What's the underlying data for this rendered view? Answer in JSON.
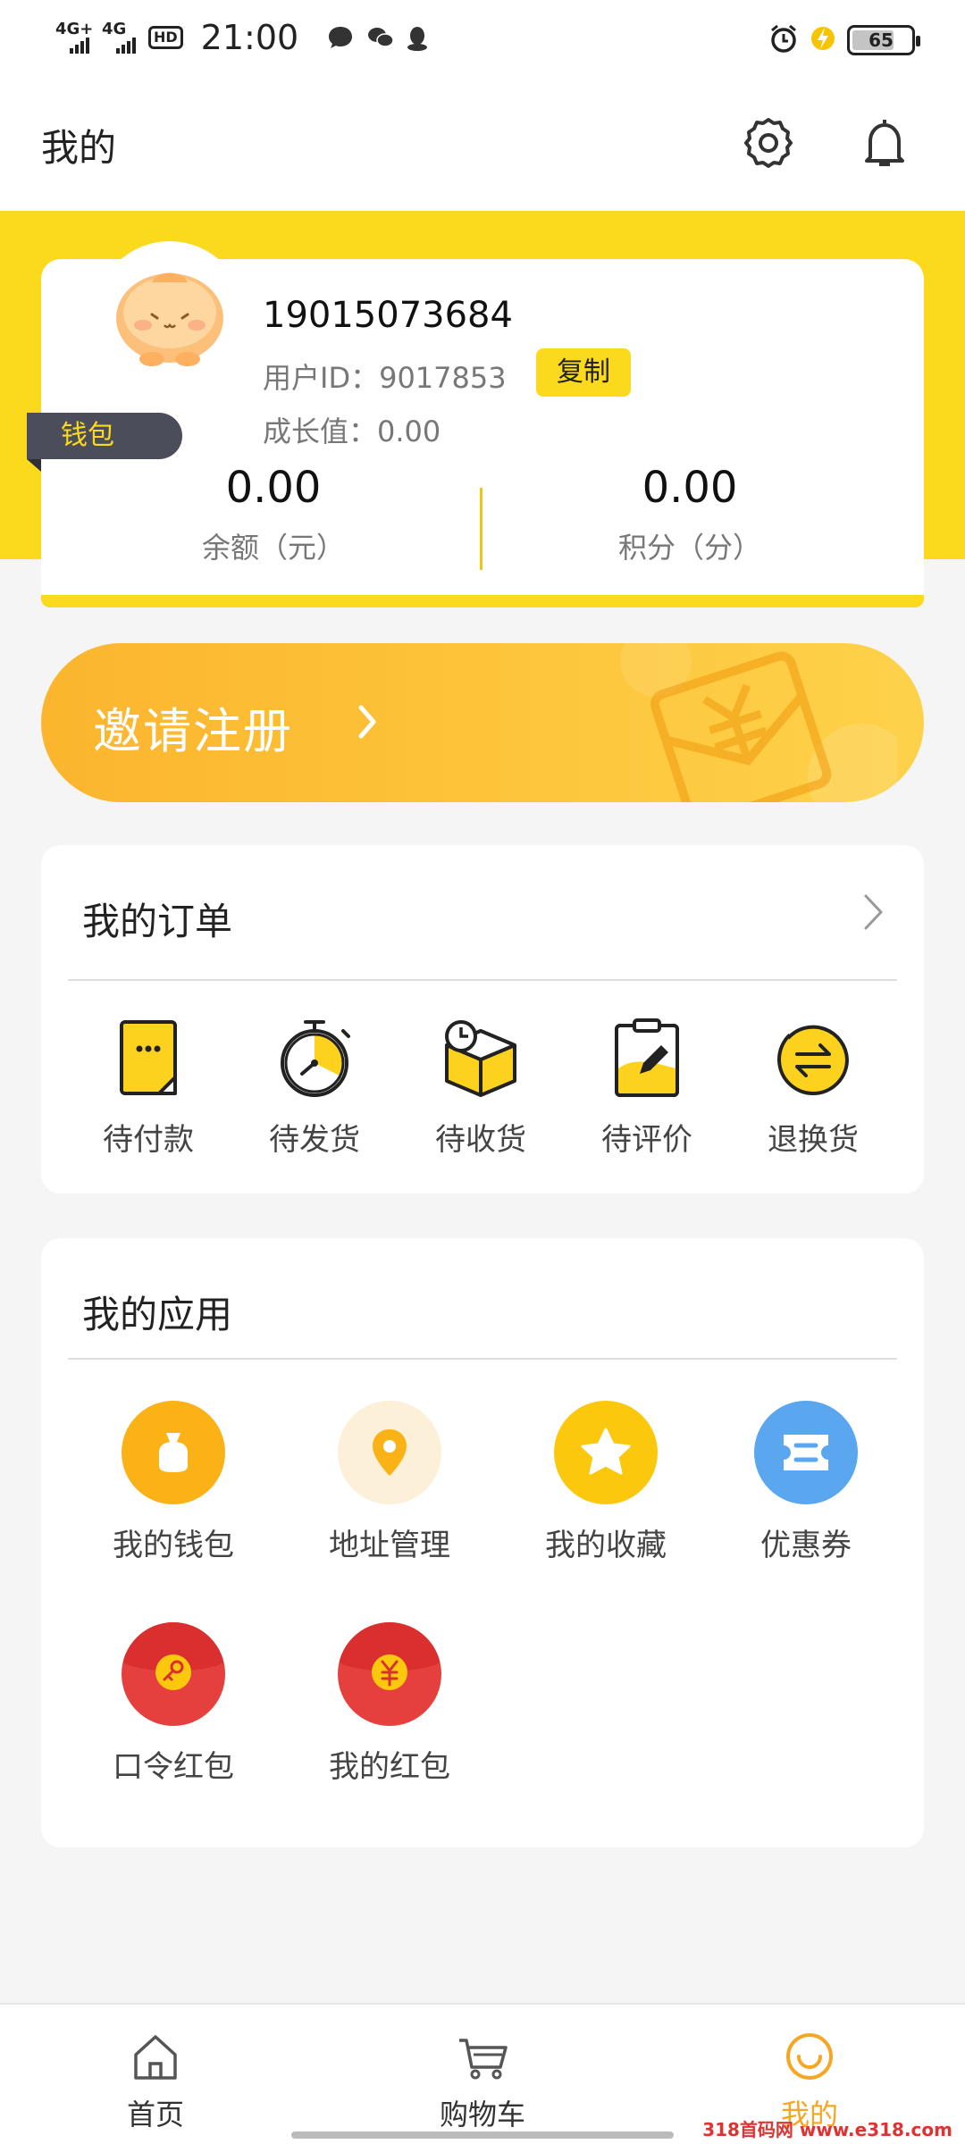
{
  "status_bar": {
    "signal_1": "4G+",
    "signal_2": "4G",
    "hd": "HD",
    "time": "21:00",
    "battery": "65"
  },
  "header": {
    "title": "我的"
  },
  "profile": {
    "phone": "19015073684",
    "user_id_label": "用户ID：9017853",
    "copy_label": "复制",
    "growth_label": "成长值：0.00",
    "wallet_tag": "钱包",
    "balance_value": "0.00",
    "balance_label": "余额（元）",
    "points_value": "0.00",
    "points_label": "积分（分）"
  },
  "invite": {
    "label": "邀请注册"
  },
  "orders": {
    "title": "我的订单",
    "items": [
      {
        "label": "待付款",
        "icon": "pending-payment-icon"
      },
      {
        "label": "待发货",
        "icon": "pending-shipment-icon"
      },
      {
        "label": "待收货",
        "icon": "pending-receipt-icon"
      },
      {
        "label": "待评价",
        "icon": "pending-review-icon"
      },
      {
        "label": "退换货",
        "icon": "return-exchange-icon"
      }
    ]
  },
  "apps": {
    "title": "我的应用",
    "items": [
      {
        "label": "我的钱包",
        "icon": "wallet-bag-icon",
        "color": "#fbb217"
      },
      {
        "label": "地址管理",
        "icon": "location-pin-icon",
        "color": "#fdf0d8"
      },
      {
        "label": "我的收藏",
        "icon": "star-icon",
        "color": "#fcc80e"
      },
      {
        "label": "优惠券",
        "icon": "coupon-icon",
        "color": "#5aa7f0"
      },
      {
        "label": "口令红包",
        "icon": "key-red-packet-icon",
        "color": "#e5403e"
      },
      {
        "label": "我的红包",
        "icon": "yuan-red-packet-icon",
        "color": "#e5403e"
      }
    ]
  },
  "bottom_nav": {
    "items": [
      {
        "label": "首页",
        "icon": "home-icon"
      },
      {
        "label": "购物车",
        "icon": "cart-icon"
      },
      {
        "label": "我的",
        "icon": "smile-profile-icon",
        "active": true
      }
    ]
  },
  "watermark": "318首码网 www.e318.com",
  "colors": {
    "accent_yellow": "#fbd91d",
    "active_orange": "#f5a623",
    "wallet_tag_bg": "#4b4e5a"
  }
}
